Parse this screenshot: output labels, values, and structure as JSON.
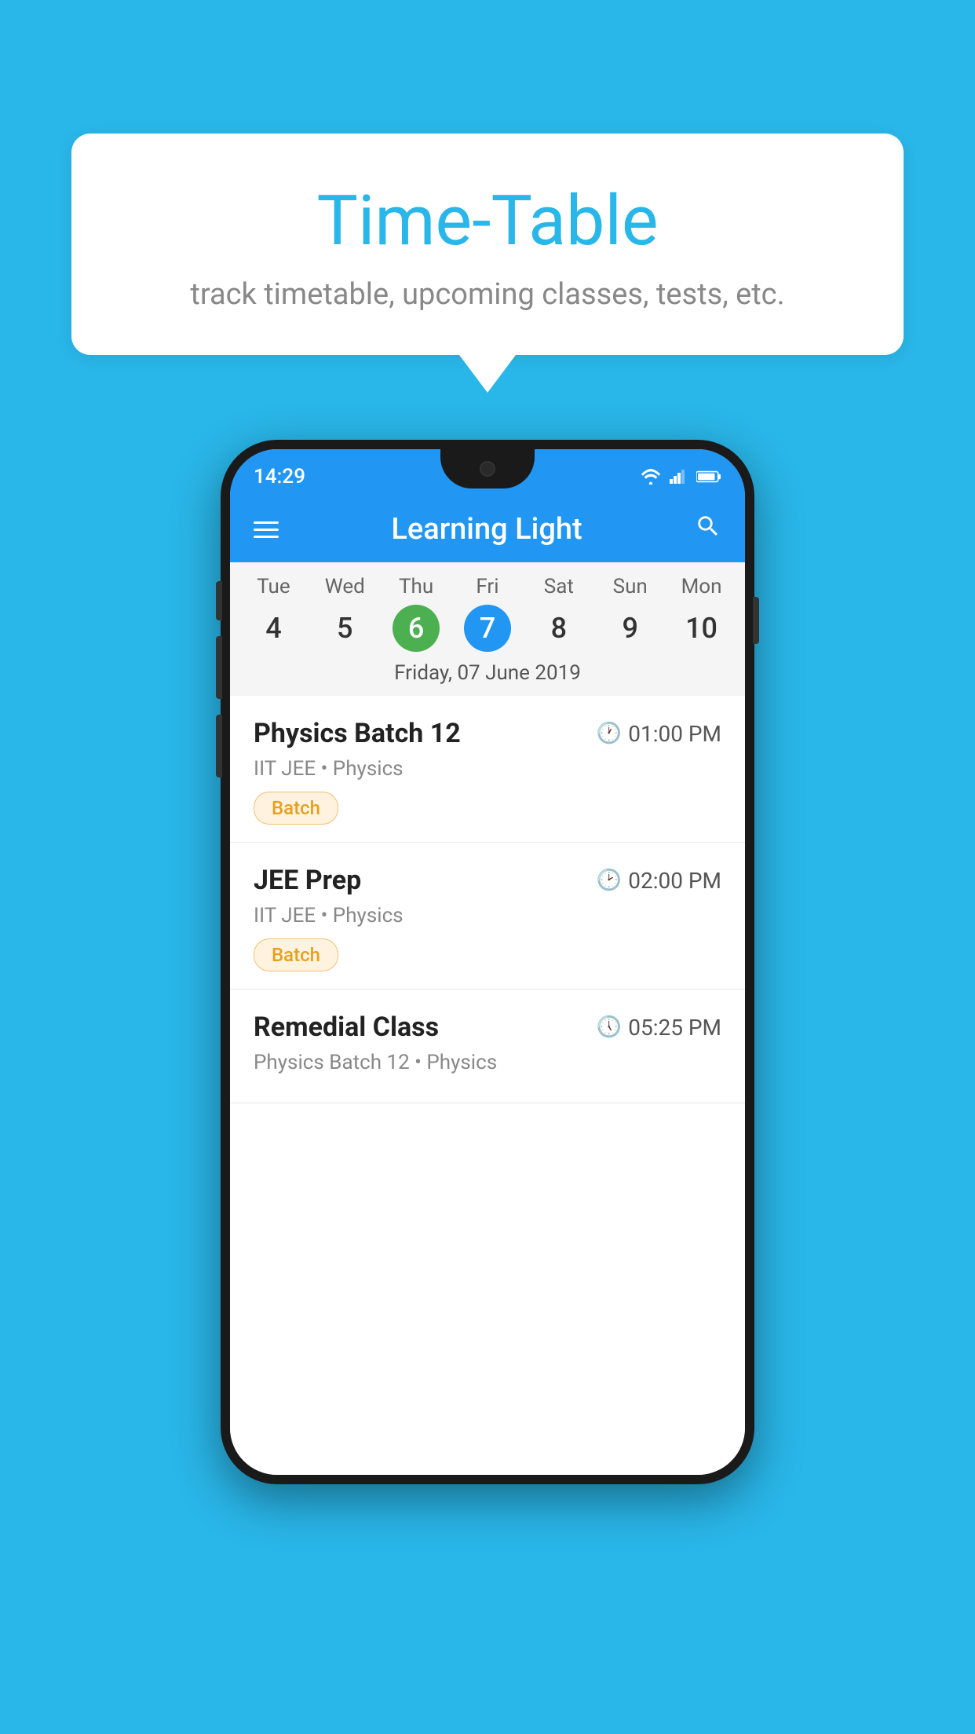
{
  "background_color": "#29b6e8",
  "speech_bubble": {
    "title": "Time-Table",
    "subtitle": "track timetable, upcoming classes, tests, etc."
  },
  "phone": {
    "status_bar": {
      "time": "14:29"
    },
    "app_bar": {
      "title": "Learning Light"
    },
    "calendar": {
      "days_of_week": [
        "Tue",
        "Wed",
        "Thu",
        "Fri",
        "Sat",
        "Sun",
        "Mon"
      ],
      "dates": [
        "4",
        "5",
        "6",
        "7",
        "8",
        "9",
        "10"
      ],
      "today_index": 2,
      "selected_index": 3,
      "selected_date_label": "Friday, 07 June 2019"
    },
    "schedule_items": [
      {
        "title": "Physics Batch 12",
        "time": "01:00 PM",
        "subtitle": "IIT JEE • Physics",
        "tag": "Batch"
      },
      {
        "title": "JEE Prep",
        "time": "02:00 PM",
        "subtitle": "IIT JEE • Physics",
        "tag": "Batch"
      },
      {
        "title": "Remedial Class",
        "time": "05:25 PM",
        "subtitle": "Physics Batch 12 • Physics",
        "tag": ""
      }
    ]
  }
}
